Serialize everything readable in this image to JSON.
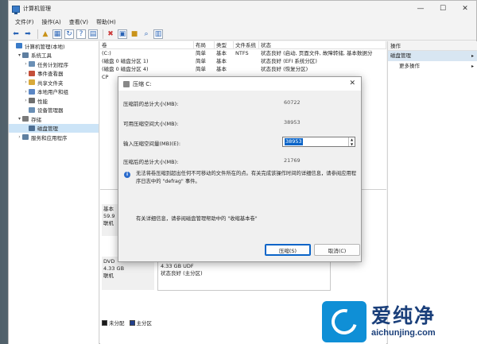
{
  "window": {
    "title": "计算机管理",
    "controls": {
      "minimize": "—",
      "maximize": "☐",
      "close": "✕"
    }
  },
  "menu": [
    "文件(F)",
    "操作(A)",
    "查看(V)",
    "帮助(H)"
  ],
  "tree": [
    {
      "label": "计算机管理(本地)",
      "indent": 0,
      "expander": "",
      "color": "#3a7bc8",
      "selected": false
    },
    {
      "label": "系统工具",
      "indent": 1,
      "expander": "▾",
      "color": "#5f7fa0",
      "selected": false
    },
    {
      "label": "任务计划程序",
      "indent": 2,
      "expander": "›",
      "color": "#6a8fb5",
      "selected": false
    },
    {
      "label": "事件查看器",
      "indent": 2,
      "expander": "›",
      "color": "#c44f3a",
      "selected": false
    },
    {
      "label": "共享文件夹",
      "indent": 2,
      "expander": "›",
      "color": "#d8a93a",
      "selected": false
    },
    {
      "label": "本地用户和组",
      "indent": 2,
      "expander": "›",
      "color": "#5b87c5",
      "selected": false
    },
    {
      "label": "性能",
      "indent": 2,
      "expander": "›",
      "color": "#6f6f6f",
      "selected": false
    },
    {
      "label": "设备管理器",
      "indent": 2,
      "expander": "",
      "color": "#6a8fb5",
      "selected": false
    },
    {
      "label": "存储",
      "indent": 1,
      "expander": "▾",
      "color": "#7a7a7a",
      "selected": false
    },
    {
      "label": "磁盘管理",
      "indent": 2,
      "expander": "",
      "color": "#4d6f93",
      "selected": true
    },
    {
      "label": "服务和应用程序",
      "indent": 1,
      "expander": "›",
      "color": "#5f7fa0",
      "selected": false
    }
  ],
  "volume_table": {
    "headers": [
      "卷",
      "布局",
      "类型",
      "文件系统",
      "状态"
    ],
    "rows": [
      [
        "(C:)",
        "简单",
        "基本",
        "NTFS",
        "状态良好 (启动, 页面文件, 故障转储, 基本数据分"
      ],
      [
        "(磁盘 0 磁盘分区 1)",
        "简单",
        "基本",
        "",
        "状态良好 (EFI 系统分区)"
      ],
      [
        "(磁盘 0 磁盘分区 4)",
        "简单",
        "基本",
        "",
        "状态良好 (恢复分区)"
      ],
      [
        "CP",
        "",
        "",
        "",
        ""
      ]
    ]
  },
  "disks": [
    {
      "lines": [
        "基本",
        "59.9",
        "联机"
      ]
    },
    {
      "lines": [
        "DVD",
        "4.33 GB",
        "联机"
      ]
    }
  ],
  "dvd_partition": {
    "lines": [
      "4.33 GB UDF",
      "状态良好 (主分区)"
    ]
  },
  "legend": [
    {
      "label": "未分配",
      "color": "#1a1a1a"
    },
    {
      "label": "主分区",
      "color": "#213f8c"
    }
  ],
  "actions": {
    "title": "操作",
    "section": "磁盘管理",
    "items": [
      "更多操作"
    ],
    "arrow": "▸"
  },
  "dialog": {
    "title": "压缩 C:",
    "close": "✕",
    "fields": [
      {
        "label": "压缩前的总计大小(MB):",
        "value": "60722"
      },
      {
        "label": "可用压缩空间大小(MB):",
        "value": "38953"
      },
      {
        "label": "输入压缩空间量(MB)(E):",
        "value": "38953"
      },
      {
        "label": "压缩后的总计大小(MB):",
        "value": "21769"
      }
    ],
    "info_icon": "i",
    "info": "无法将卷压缩到超出任何不可移动的文件所在的点。有关完成该操作时间的详细信息，请参阅应用程序日志中的 \"defrag\" 事件。",
    "more_info": "有关详细信息，请参阅磁盘管理帮助中的 \"收缩基本卷\"",
    "shrink_button": "压缩(S)",
    "cancel_button": "取消(C)"
  },
  "watermark": {
    "brand": "爱纯净",
    "url": "aichunjing.com"
  }
}
